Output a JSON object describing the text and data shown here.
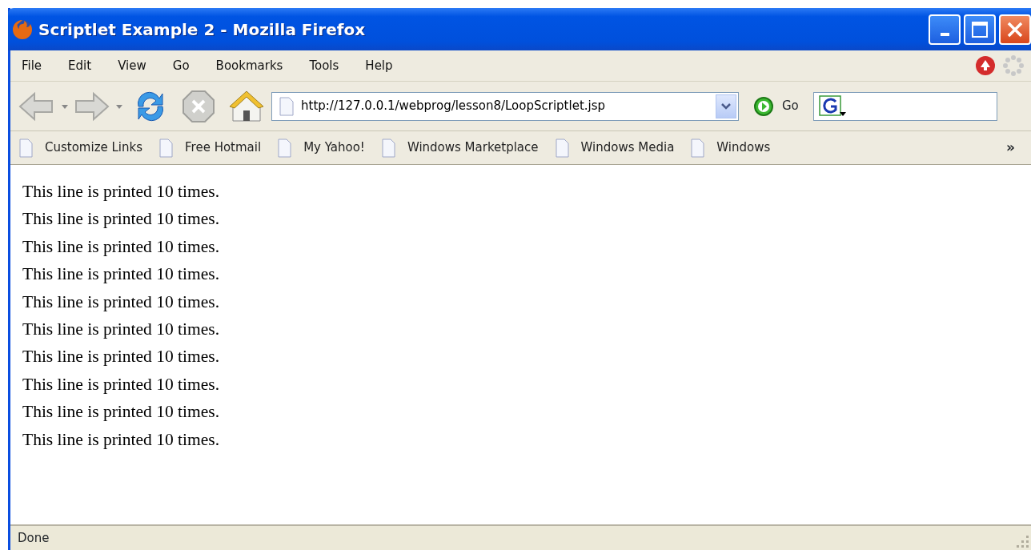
{
  "window": {
    "title": "Scriptlet Example 2 - Mozilla Firefox"
  },
  "menu": [
    "File",
    "Edit",
    "View",
    "Go",
    "Bookmarks",
    "Tools",
    "Help"
  ],
  "address_bar": {
    "value": "http://127.0.0.1/webprog/lesson8/LoopScriptlet.jsp"
  },
  "go_button": {
    "label": "Go"
  },
  "bookmarks": [
    "Customize Links",
    "Free Hotmail",
    "My Yahoo!",
    "Windows Marketplace",
    "Windows Media",
    "Windows"
  ],
  "bookmarks_overflow": "»",
  "content": {
    "lines": [
      "This line is printed 10 times.",
      "This line is printed 10 times.",
      "This line is printed 10 times.",
      "This line is printed 10 times.",
      "This line is printed 10 times.",
      "This line is printed 10 times.",
      "This line is printed 10 times.",
      "This line is printed 10 times.",
      "This line is printed 10 times.",
      "This line is printed 10 times."
    ]
  },
  "status_bar": {
    "text": "Done"
  }
}
